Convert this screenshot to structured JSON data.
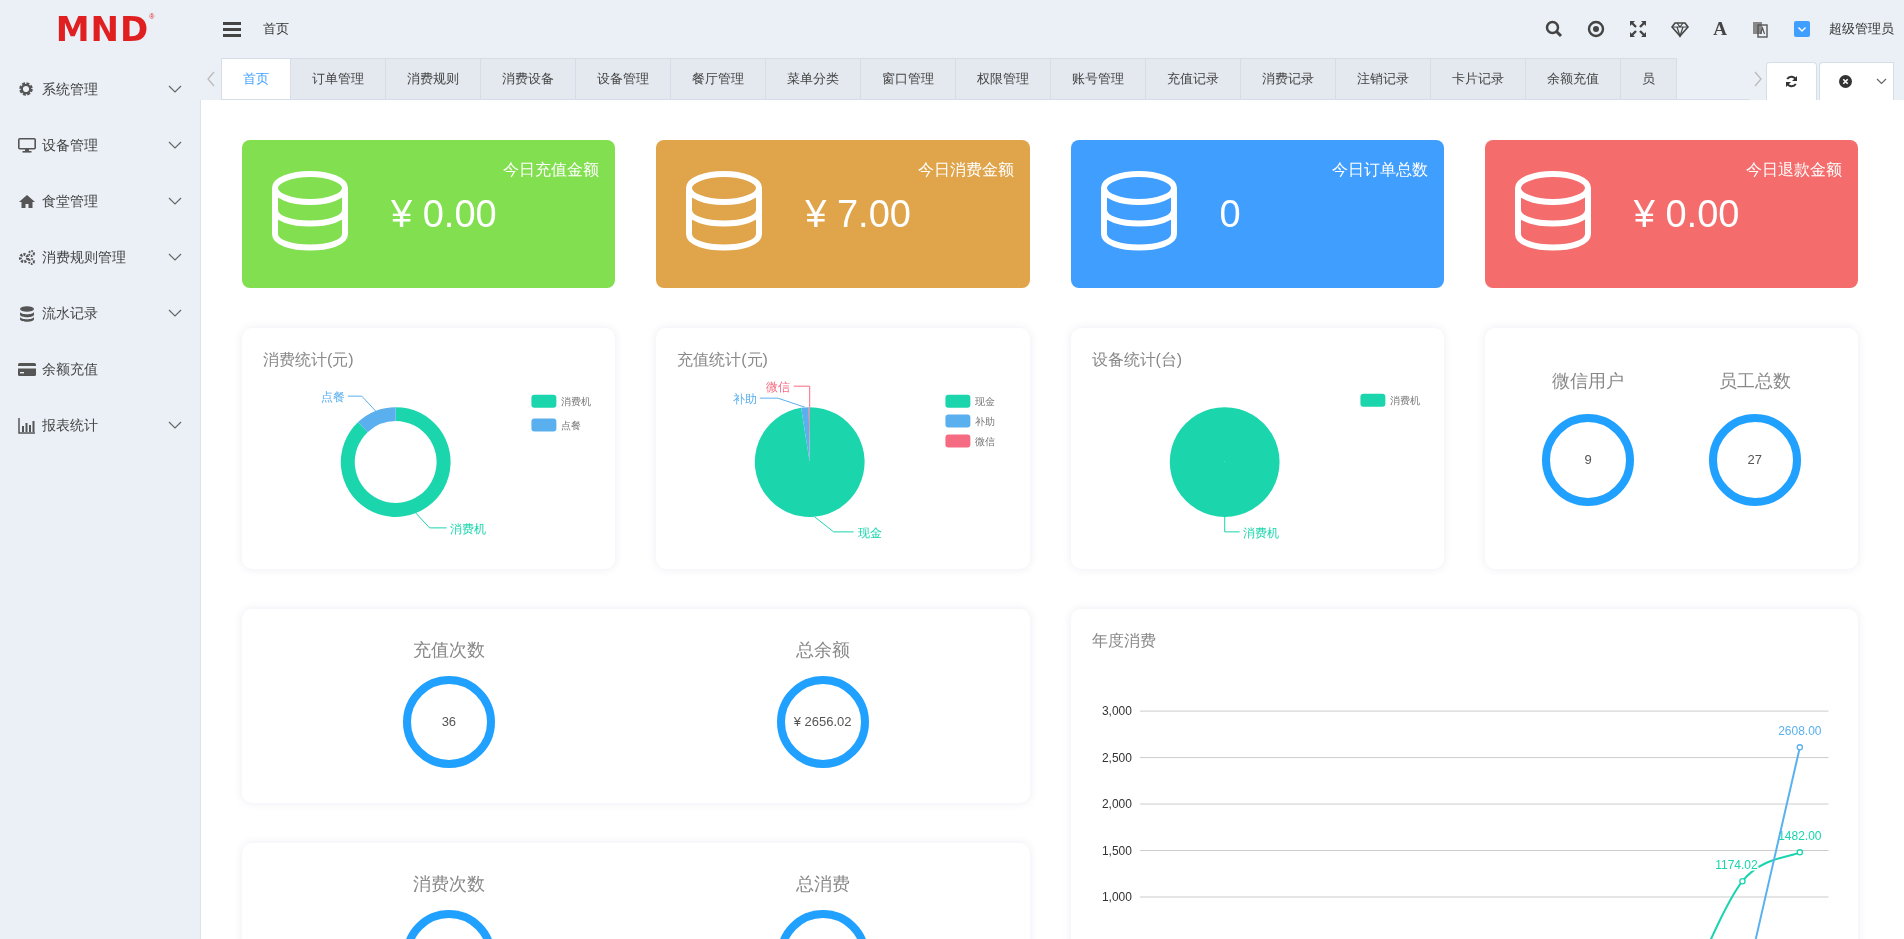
{
  "logo": {
    "text": "MND",
    "mark": "®"
  },
  "header": {
    "breadcrumb": "首页",
    "font_button": "A",
    "user": "超级管理员"
  },
  "sidebar": {
    "items": [
      {
        "label": "系统管理",
        "kind": "group"
      },
      {
        "label": "设备管理",
        "kind": "group"
      },
      {
        "label": "食堂管理",
        "kind": "group"
      },
      {
        "label": "消费规则管理",
        "kind": "group"
      },
      {
        "label": "流水记录",
        "kind": "group"
      },
      {
        "label": "余额充值",
        "kind": "link"
      },
      {
        "label": "报表统计",
        "kind": "group"
      }
    ]
  },
  "tabs": [
    {
      "label": "首页",
      "selected": true
    },
    {
      "label": "订单管理",
      "selected": false
    },
    {
      "label": "消费规则",
      "selected": false
    },
    {
      "label": "消费设备",
      "selected": false
    },
    {
      "label": "设备管理",
      "selected": false
    },
    {
      "label": "餐厅管理",
      "selected": false
    },
    {
      "label": "菜单分类",
      "selected": false
    },
    {
      "label": "窗口管理",
      "selected": false
    },
    {
      "label": "权限管理",
      "selected": false
    },
    {
      "label": "账号管理",
      "selected": false
    },
    {
      "label": "充值记录",
      "selected": false
    },
    {
      "label": "消费记录",
      "selected": false
    },
    {
      "label": "注销记录",
      "selected": false
    },
    {
      "label": "卡片记录",
      "selected": false
    },
    {
      "label": "余额充值",
      "selected": false
    },
    {
      "label": "员",
      "selected": false
    }
  ],
  "stat_cards": [
    {
      "title": "今日充值金额",
      "value": "¥ 0.00",
      "color": "#82e050"
    },
    {
      "title": "今日消费金额",
      "value": "¥ 7.00",
      "color": "#e0a44a"
    },
    {
      "title": "今日订单总数",
      "value": "0",
      "color": "#409eff"
    },
    {
      "title": "今日退款金额",
      "value": "¥ 0.00",
      "color": "#f56c6c"
    }
  ],
  "pie_cards": [
    {
      "title": "消费统计(元)",
      "kind": "donut",
      "slices": [
        {
          "legend": "消费机",
          "callout": "消费机",
          "color": "#1bd5ad"
        },
        {
          "legend": "点餐",
          "callout": "点餐",
          "color": "#5aafef"
        }
      ]
    },
    {
      "title": "充值统计(元)",
      "kind": "pie",
      "slices": [
        {
          "legend": "现金",
          "callout": "现金",
          "color": "#1bd5ad"
        },
        {
          "legend": "补助",
          "callout": "补助",
          "color": "#5aafef"
        },
        {
          "legend": "微信",
          "callout": "微信",
          "color": "#f56c82"
        }
      ]
    },
    {
      "title": "设备统计(台)",
      "kind": "pie",
      "slices": [
        {
          "legend": "消费机",
          "callout": "消费机",
          "color": "#1bd5ad"
        }
      ]
    }
  ],
  "user_stats": [
    {
      "label": "微信用户",
      "value": "9"
    },
    {
      "label": "员工总数",
      "value": "27"
    }
  ],
  "recharge_stats": [
    {
      "label": "充值次数",
      "value": "36"
    },
    {
      "label": "总余额",
      "value": "¥ 2656.02"
    }
  ],
  "consume_stats": [
    {
      "label": "消费次数"
    },
    {
      "label": "总消费"
    }
  ],
  "annual_chart": {
    "chart_data": {
      "type": "line",
      "title": "年度消费",
      "grid": true,
      "ylim": [
        1000,
        3000
      ],
      "yticks": [
        {
          "value": 1000,
          "label": "1,000"
        },
        {
          "value": 1500,
          "label": "1,500"
        },
        {
          "value": 2000,
          "label": "2,000"
        },
        {
          "value": 2500,
          "label": "2,500"
        },
        {
          "value": 3000,
          "label": "3,000"
        }
      ],
      "series": [
        {
          "color": "#19d4ae",
          "marker": "circle",
          "values": [
            null,
            null,
            null,
            null,
            null,
            null,
            null,
            null,
            null,
            null,
            1170,
            1480
          ]
        },
        {
          "color": "#5ab1ef",
          "marker": "circle",
          "values": [
            null,
            null,
            null,
            null,
            null,
            null,
            null,
            null,
            null,
            null,
            null,
            2610
          ]
        }
      ],
      "value_labels": [
        [
          null,
          null,
          null,
          null,
          null,
          null,
          null,
          null,
          null,
          null,
          "1174.02",
          "1482.00"
        ],
        [
          null,
          null,
          null,
          null,
          null,
          null,
          null,
          null,
          null,
          null,
          null,
          "2608.00"
        ]
      ]
    }
  }
}
